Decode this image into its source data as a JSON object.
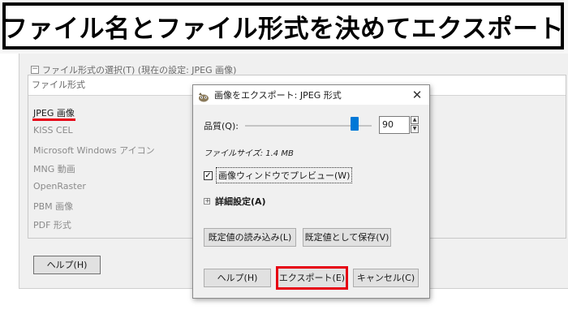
{
  "banner": {
    "title": "ファイル名とファイル形式を決めてエクスポート"
  },
  "background_window": {
    "file_type_header": "ファイル形式の選択(T) (現在の設定: JPEG 画像)",
    "list_header": "ファイル形式",
    "file_types": [
      "JPEG 画像",
      "KISS CEL",
      "Microsoft Windows アイコン",
      "MNG 動画",
      "OpenRaster",
      "PBM 画像",
      "PDF 形式"
    ],
    "help_button": "ヘルプ(H)"
  },
  "dialog": {
    "title": "画像をエクスポート: JPEG 形式",
    "close_glyph": "✕",
    "quality_label": "品質(Q):",
    "quality_value": "90",
    "quality_slider_fraction": 0.9,
    "file_size": "ファイルサイズ: 1.4 MB",
    "preview_checked": true,
    "preview_label": "画像ウィンドウでプレビュー(W)",
    "advanced_label": "詳細設定(A)",
    "load_defaults": "既定値の読み込み(L)",
    "save_defaults": "既定値として保存(V)",
    "help": "ヘルプ(H)",
    "export": "エクスポート(E)",
    "cancel": "キャンセル(C)"
  },
  "colors": {
    "highlight_red": "#e60012",
    "slider_blue": "#0078d7"
  }
}
